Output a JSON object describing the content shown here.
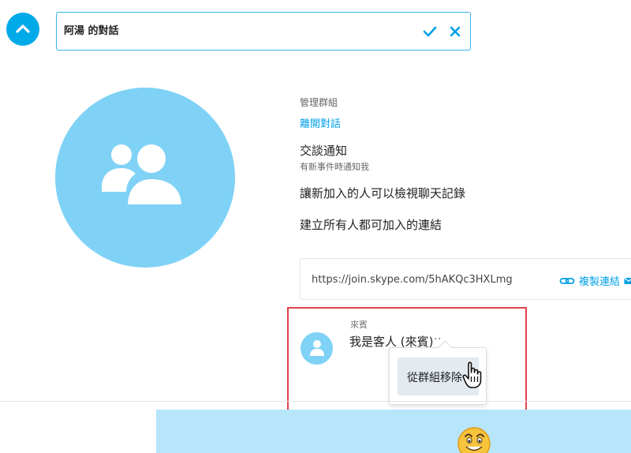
{
  "header": {
    "title_value": "阿湯 的對話"
  },
  "settings": {
    "manage_group_label": "管理群組",
    "leave_conversation": "離開對話",
    "notifications_title": "交談通知",
    "notifications_subtitle": "有新事件時通知我",
    "history_setting": "讓新加入的人可以檢視聊天記錄",
    "join_link_setting": "建立所有人都可加入的連結"
  },
  "join_link": {
    "url": "https://join.skype.com/5hAKQc3HXLmg",
    "copy_label": "複製連結"
  },
  "participant": {
    "role": "來賓",
    "name": "我是客人 (來賓)",
    "more": "··"
  },
  "context_menu": {
    "remove_label": "從群組移除"
  },
  "colors": {
    "accent": "#00a9e8",
    "link": "#00a0e6",
    "avatar_bg": "#7fd2f6",
    "highlight": "#e0424a"
  }
}
